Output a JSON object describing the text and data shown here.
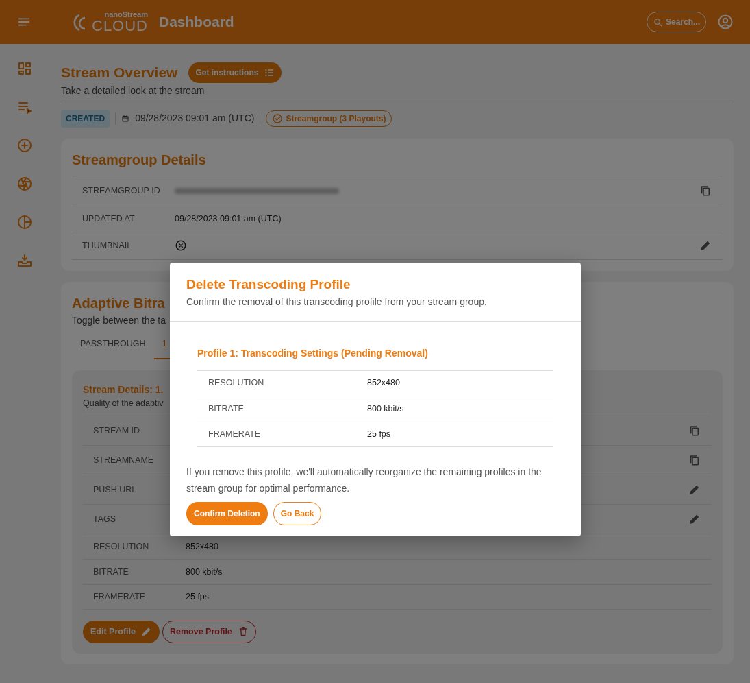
{
  "header": {
    "logo_top": "nanoStream",
    "logo_bottom": "CLOUD",
    "title": "Dashboard",
    "search_label": "Search..."
  },
  "overview": {
    "title": "Stream Overview",
    "instructions_button": "Get instructions",
    "subtitle": "Take a detailed look at the stream",
    "status": "CREATED",
    "created": "09/28/2023 09:01 am (UTC)",
    "group_pill": "Streamgroup (3 Playouts)"
  },
  "streamgroup_details": {
    "title": "Streamgroup Details",
    "rows": [
      {
        "label": "STREAMGROUP ID",
        "kind": "redacted_copy"
      },
      {
        "label": "UPDATED AT",
        "kind": "text",
        "value": "09/28/2023 09:01 am (UTC)"
      },
      {
        "label": "THUMBNAIL",
        "kind": "missing_edit"
      }
    ]
  },
  "adaptive_bitrate": {
    "title": "Adaptive Bitra",
    "subtitle": "Toggle between the ta",
    "tabs": [
      {
        "label": "PASSTHROUGH",
        "selected": false
      },
      {
        "label": "1",
        "selected": true
      }
    ],
    "stream_details": {
      "title": "Stream Details: 1.",
      "subtitle": "Quality of the adaptiv",
      "rows": [
        {
          "label": "STREAM ID",
          "kind": "copy"
        },
        {
          "label": "STREAMNAME",
          "kind": "copy"
        },
        {
          "label": "PUSH URL",
          "kind": "edit"
        },
        {
          "label": "TAGS",
          "kind": "edit"
        },
        {
          "label": "RESOLUTION",
          "kind": "text",
          "value": "852x480"
        },
        {
          "label": "BITRATE",
          "kind": "text",
          "value": "800 kbit/s"
        },
        {
          "label": "FRAMERATE",
          "kind": "text",
          "value": "25 fps"
        }
      ],
      "buttons": [
        {
          "label": "Edit Profile",
          "kind": "edit"
        },
        {
          "label": "Remove Profile",
          "kind": "remove"
        }
      ]
    }
  },
  "modal": {
    "title": "Delete Transcoding Profile",
    "subtitle": "Confirm the removal of this transcoding profile from your stream group.",
    "profile_title": "Profile 1: Transcoding Settings (Pending Removal)",
    "rows": [
      {
        "label": "RESOLUTION",
        "value": "852x480"
      },
      {
        "label": "BITRATE",
        "value": "800 kbit/s"
      },
      {
        "label": "FRAMERATE",
        "value": "25 fps"
      }
    ],
    "note": "If you remove this profile, we'll automatically reorganize the remaining profiles in the stream group for optimal performance.",
    "buttons": [
      {
        "label": "Confirm Deletion",
        "kind": "primary"
      },
      {
        "label": "Go Back",
        "kind": "secondary"
      }
    ]
  }
}
